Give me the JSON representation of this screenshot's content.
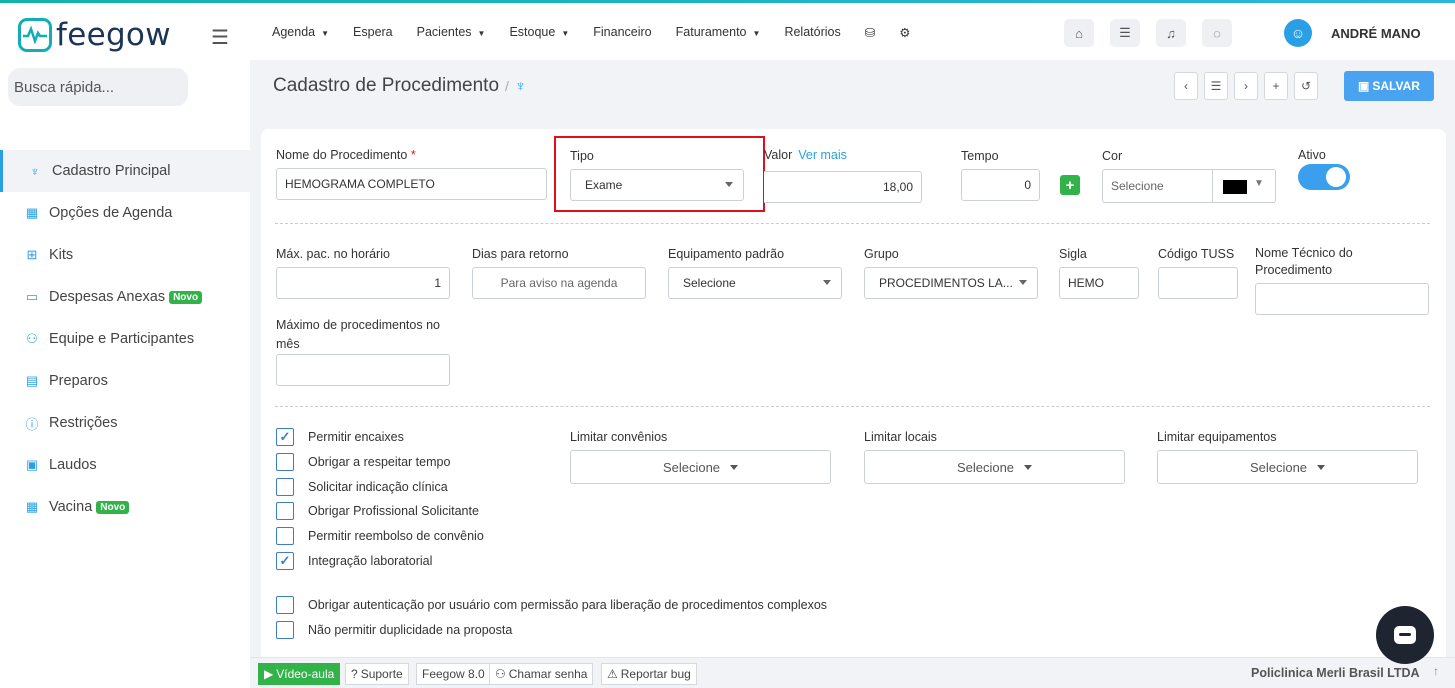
{
  "brand": {
    "name": "feegow",
    "accent": "#11aeb5",
    "primary": "#2b9fe6"
  },
  "sidebar": {
    "search_placeholder": "Busca rápida...",
    "items": [
      {
        "label": "Cadastro Principal",
        "icon": "stethoscope-icon",
        "active": true
      },
      {
        "label": "Opções de Agenda",
        "icon": "calendar-icon"
      },
      {
        "label": "Kits",
        "icon": "kit-icon"
      },
      {
        "label": "Despesas Anexas",
        "icon": "card-icon",
        "badge": "Novo"
      },
      {
        "label": "Equipe e Participantes",
        "icon": "team-icon"
      },
      {
        "label": "Preparos",
        "icon": "list-icon"
      },
      {
        "label": "Restrições",
        "icon": "alert-icon"
      },
      {
        "label": "Laudos",
        "icon": "document-icon"
      },
      {
        "label": "Vacina",
        "icon": "calendar-icon",
        "badge": "Novo"
      }
    ]
  },
  "topbar": {
    "menu": [
      "Agenda",
      "Espera",
      "Pacientes",
      "Estoque",
      "Financeiro",
      "Faturamento",
      "Relatórios"
    ],
    "menu_dropdown": [
      true,
      false,
      true,
      true,
      false,
      true,
      false
    ],
    "username": "ANDRÉ MANO"
  },
  "header": {
    "title": "Cadastro de Procedimento",
    "save_label": "SALVAR"
  },
  "form": {
    "nome_label": "Nome do Procedimento",
    "nome_value": "HEMOGRAMA COMPLETO",
    "tipo_label": "Tipo",
    "tipo_value": "Exame",
    "valor_label": "Valor",
    "valor_link": "Ver mais",
    "valor_value": "18,00",
    "tempo_label": "Tempo",
    "tempo_value": "0",
    "cor_label": "Cor",
    "cor_placeholder": "Selecione",
    "cor_value": "#000000",
    "ativo_label": "Ativo",
    "ativo_on": true,
    "maxpac_label": "Máx. pac. no horário",
    "maxpac_value": "1",
    "dias_label": "Dias para retorno",
    "dias_placeholder": "Para aviso na agenda",
    "equip_label": "Equipamento padrão",
    "equip_value": "Selecione",
    "grupo_label": "Grupo",
    "grupo_value": "PROCEDIMENTOS LA...",
    "sigla_label": "Sigla",
    "sigla_value": "HEMO",
    "tuss_label": "Código TUSS",
    "tuss_value": "",
    "nometec_label": "Nome Técnico do Procedimento",
    "nometec_value": "",
    "maxproc_label": "Máximo de procedimentos no mês",
    "maxproc_value": ""
  },
  "checkboxes": [
    {
      "label": "Permitir encaixes",
      "checked": true
    },
    {
      "label": "Obrigar a respeitar tempo",
      "checked": false
    },
    {
      "label": "Solicitar indicação clínica",
      "checked": false
    },
    {
      "label": "Obrigar Profissional Solicitante",
      "checked": false
    },
    {
      "label": "Permitir reembolso de convênio",
      "checked": false
    },
    {
      "label": "Integração laboratorial",
      "checked": true
    },
    {
      "label": "Obrigar autenticação por usuário com permissão para liberação de procedimentos complexos",
      "checked": false
    },
    {
      "label": "Não permitir duplicidade na proposta",
      "checked": false
    }
  ],
  "limits": {
    "convenios_label": "Limitar convênios",
    "locais_label": "Limitar locais",
    "equipamentos_label": "Limitar equipamentos",
    "select_label": "Selecione"
  },
  "footer": {
    "video": "Vídeo-aula",
    "suporte": "Suporte",
    "version": "Feegow 8.0",
    "chamar": "Chamar senha",
    "bug": "Reportar bug",
    "company": "Policlinica Merli Brasil LTDA"
  }
}
